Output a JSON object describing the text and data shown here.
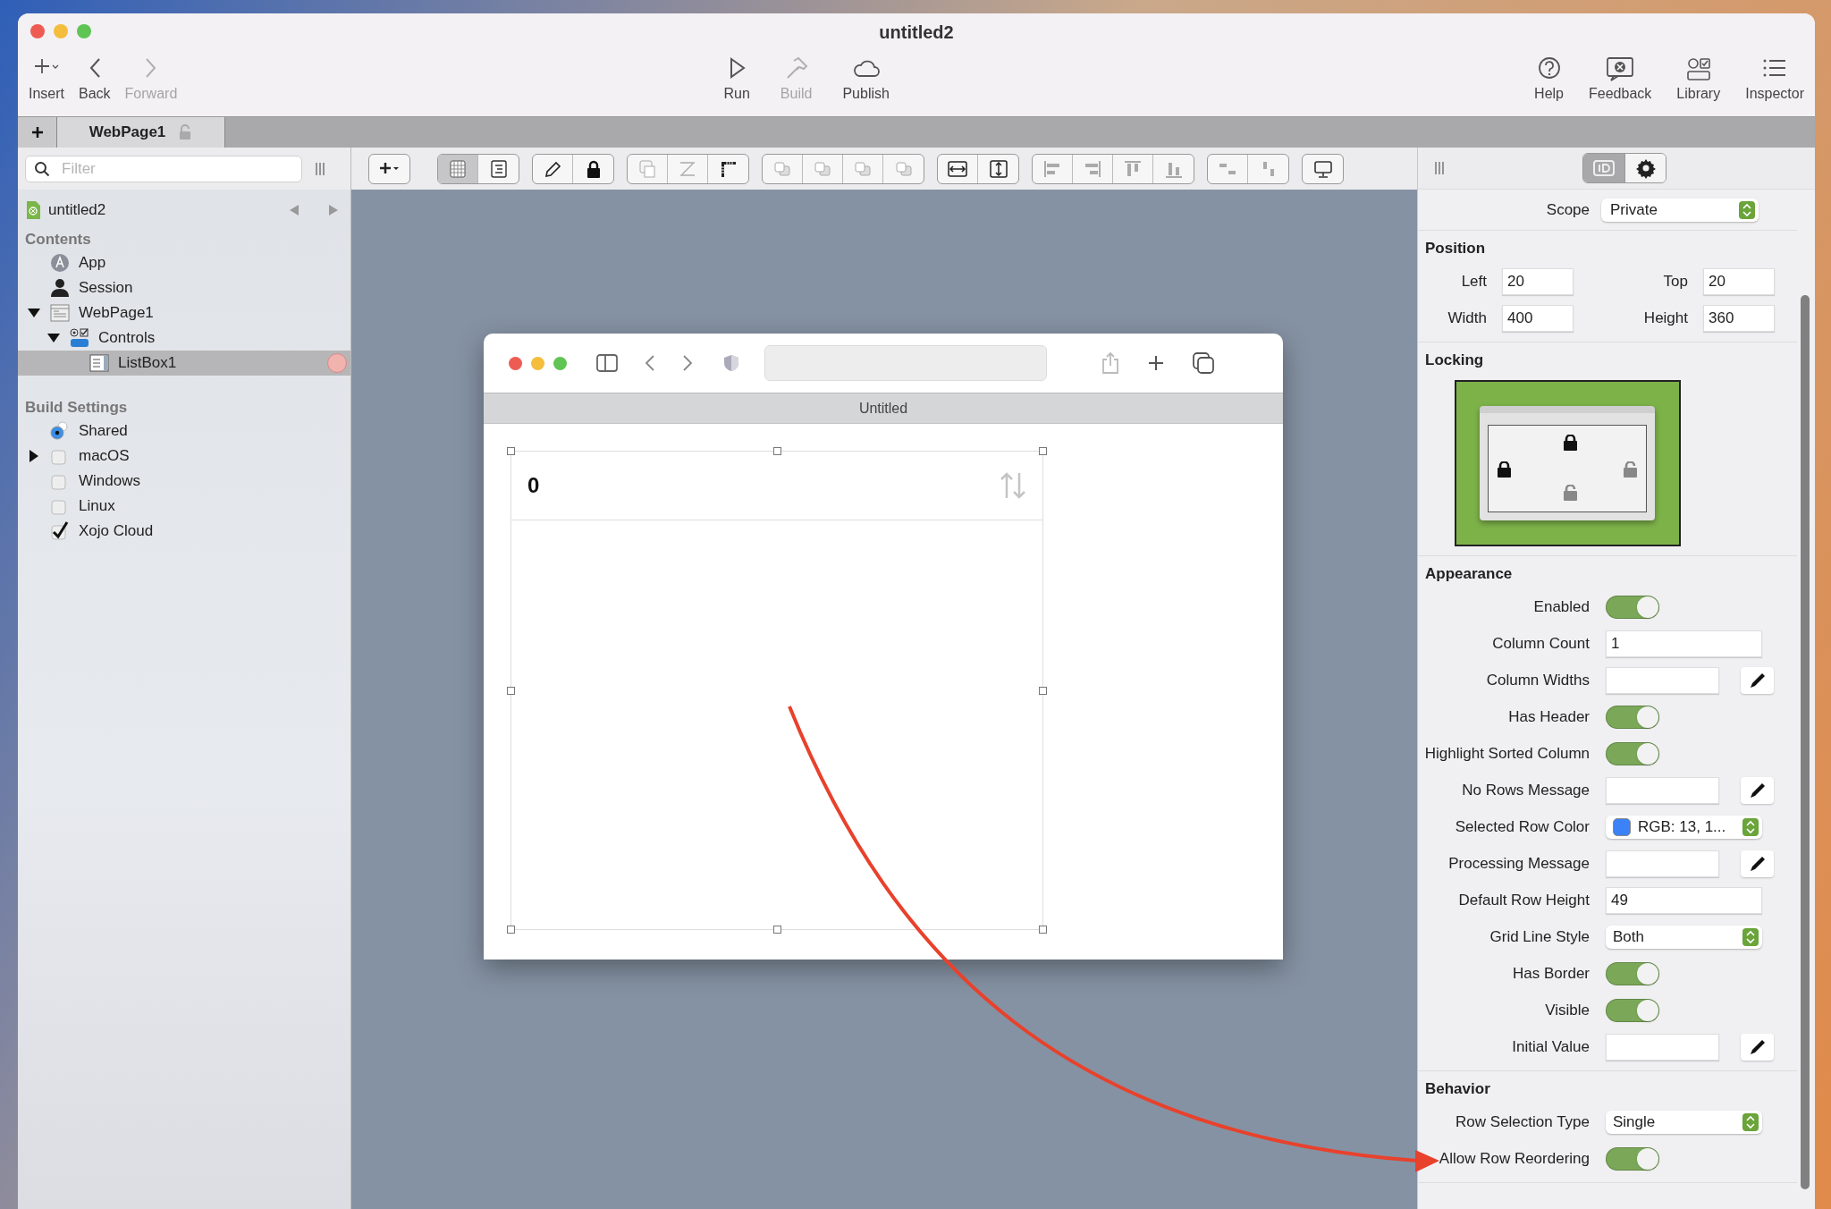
{
  "window": {
    "title": "untitled2"
  },
  "toolbar": {
    "left": [
      {
        "label": "Insert",
        "disabled": false
      },
      {
        "label": "Back",
        "disabled": false
      },
      {
        "label": "Forward",
        "disabled": true
      }
    ],
    "center": [
      {
        "label": "Run",
        "disabled": false
      },
      {
        "label": "Build",
        "disabled": true
      },
      {
        "label": "Publish",
        "disabled": false
      }
    ],
    "right": [
      {
        "label": "Help",
        "disabled": false
      },
      {
        "label": "Feedback",
        "disabled": false
      },
      {
        "label": "Library",
        "disabled": false
      },
      {
        "label": "Inspector",
        "disabled": false
      }
    ]
  },
  "tabs": [
    {
      "label": "WebPage1",
      "selected": true,
      "locked": false
    }
  ],
  "filter": {
    "placeholder": "Filter"
  },
  "editor_toolbar": {
    "view_buttons": [
      {
        "selected": true
      },
      {
        "selected": false
      }
    ]
  },
  "sidebar": {
    "project": "untitled2",
    "sections": [
      {
        "title": "Contents",
        "items": [
          {
            "label": "App",
            "kind": "app",
            "selected": false
          },
          {
            "label": "Session",
            "kind": "session",
            "selected": false
          },
          {
            "label": "WebPage1",
            "kind": "webpage",
            "selected": false,
            "expanded": true,
            "children": [
              {
                "label": "Controls",
                "kind": "controls",
                "selected": false,
                "expanded": true,
                "children": [
                  {
                    "label": "ListBox1",
                    "kind": "listbox",
                    "selected": true,
                    "flagged": true
                  }
                ]
              }
            ]
          }
        ]
      },
      {
        "title": "Build Settings",
        "items": [
          {
            "label": "Shared",
            "kind": "radio",
            "checked": true
          },
          {
            "label": "macOS",
            "kind": "checkbox",
            "checked": false,
            "expanded": false
          },
          {
            "label": "Windows",
            "kind": "checkbox",
            "checked": false
          },
          {
            "label": "Linux",
            "kind": "checkbox",
            "checked": false
          },
          {
            "label": "Xojo Cloud",
            "kind": "checkbox",
            "checked": true
          }
        ]
      }
    ]
  },
  "canvas": {
    "browser_title": "Untitled",
    "listbox_header": "0"
  },
  "inspector": {
    "tabs": [
      {
        "selected": true
      },
      {
        "selected": false
      }
    ],
    "scope": {
      "label": "Scope",
      "value": "Private"
    },
    "sections": [
      {
        "title": "Position",
        "rows": [
          {
            "kind": "pair",
            "items": [
              {
                "label": "Left",
                "value": "20"
              },
              {
                "label": "Top",
                "value": "20"
              }
            ]
          },
          {
            "kind": "pair",
            "items": [
              {
                "label": "Width",
                "value": "400"
              },
              {
                "label": "Height",
                "value": "360"
              }
            ]
          }
        ]
      },
      {
        "title": "Locking",
        "rows": [
          {
            "kind": "locking",
            "top": true,
            "left": true,
            "right": false,
            "bottom": false
          }
        ]
      },
      {
        "title": "Appearance",
        "rows": [
          {
            "kind": "toggle",
            "label": "Enabled",
            "on": true
          },
          {
            "kind": "field",
            "label": "Column Count",
            "value": "1"
          },
          {
            "kind": "edit",
            "label": "Column Widths"
          },
          {
            "kind": "toggle",
            "label": "Has Header",
            "on": true
          },
          {
            "kind": "toggle",
            "label": "Highlight Sorted Column",
            "on": true
          },
          {
            "kind": "edit",
            "label": "No Rows Message"
          },
          {
            "kind": "color",
            "label": "Selected Row Color",
            "value": "RGB: 13, 1...",
            "color": "#3b82f6"
          },
          {
            "kind": "edit",
            "label": "Processing Message"
          },
          {
            "kind": "field",
            "label": "Default Row Height",
            "value": "49"
          },
          {
            "kind": "popup",
            "label": "Grid Line Style",
            "value": "Both"
          },
          {
            "kind": "toggle",
            "label": "Has Border",
            "on": true
          },
          {
            "kind": "toggle",
            "label": "Visible",
            "on": true
          },
          {
            "kind": "edit",
            "label": "Initial Value"
          }
        ]
      },
      {
        "title": "Behavior",
        "rows": [
          {
            "kind": "popup",
            "label": "Row Selection Type",
            "value": "Single"
          },
          {
            "kind": "toggle",
            "label": "Allow Row Reordering",
            "on": true
          }
        ]
      }
    ]
  }
}
